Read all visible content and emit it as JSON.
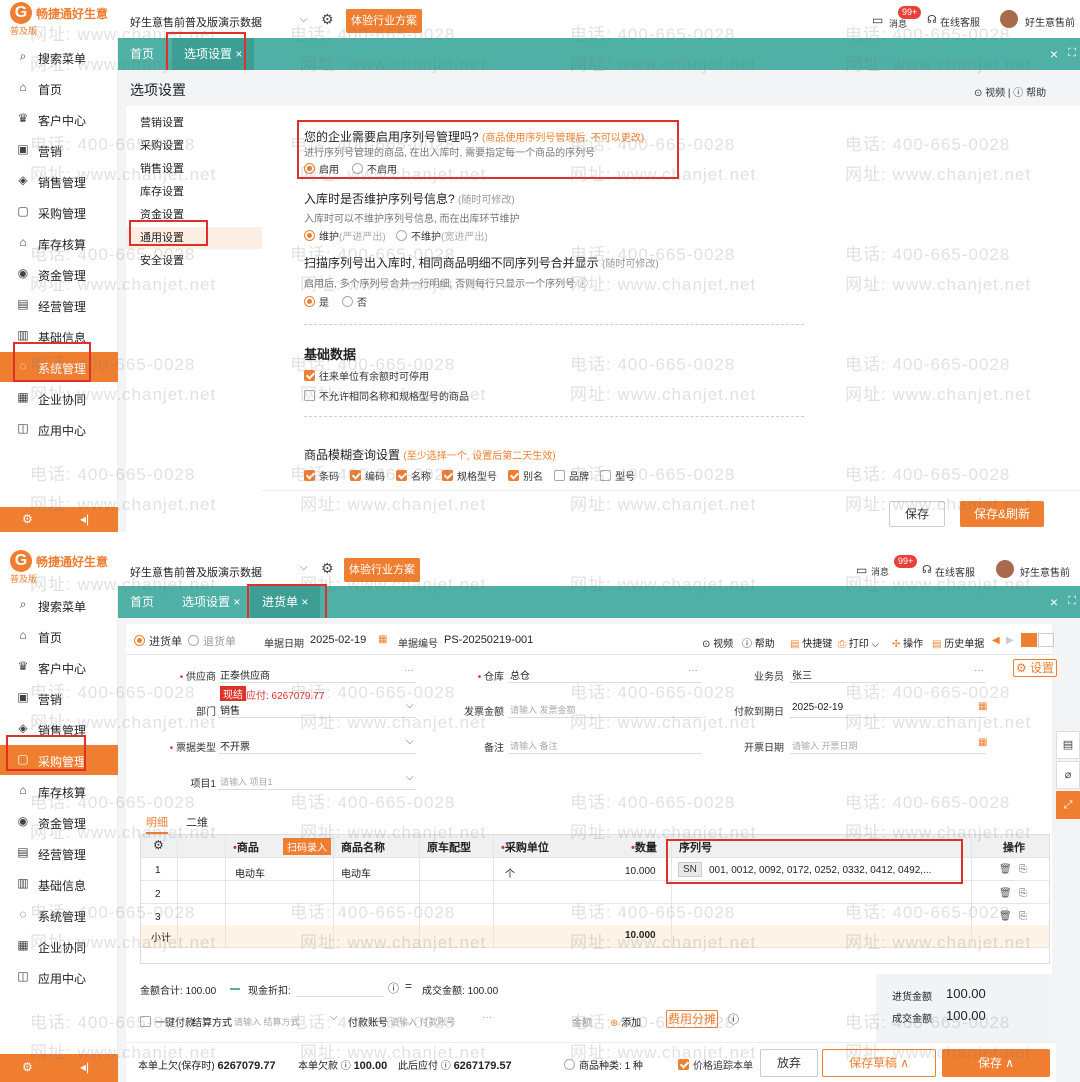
{
  "brand": {
    "name": "畅捷通好生意",
    "edition": "普及版",
    "logo_letter": "G"
  },
  "topbar": {
    "org_name": "好生意售前普及版演示数据",
    "try_button": "体验行业方案",
    "messages_label": "消息",
    "messages_badge": "99+",
    "service_label": "在线客服",
    "user_name": "好生意售前"
  },
  "sidebar": {
    "items": [
      {
        "icon": "search-icon",
        "glyph": "⌕",
        "label": "搜索菜单"
      },
      {
        "icon": "home-icon",
        "glyph": "⌂",
        "label": "首页"
      },
      {
        "icon": "trophy-icon",
        "glyph": "♛",
        "label": "客户中心"
      },
      {
        "icon": "gift-icon",
        "glyph": "▣",
        "label": "营销"
      },
      {
        "icon": "sales-icon",
        "glyph": "◈",
        "label": "销售管理"
      },
      {
        "icon": "purchase-icon",
        "glyph": "▢",
        "label": "采购管理"
      },
      {
        "icon": "warehouse-icon",
        "glyph": "⌂",
        "label": "库存核算"
      },
      {
        "icon": "money-icon",
        "glyph": "◉",
        "label": "资金管理"
      },
      {
        "icon": "report-icon",
        "glyph": "▤",
        "label": "经营管理"
      },
      {
        "icon": "info-icon",
        "glyph": "▥",
        "label": "基础信息"
      },
      {
        "icon": "system-icon",
        "glyph": "◌",
        "label": "系统管理"
      },
      {
        "icon": "cooperation-icon",
        "glyph": "▦",
        "label": "企业协同"
      },
      {
        "icon": "app-icon",
        "glyph": "◫",
        "label": "应用中心"
      }
    ],
    "footer_left_icon": "gear-icon",
    "footer_right_icon": "collapse-icon"
  },
  "watermark": {
    "phone": "电话: 400-665-0028",
    "site": "网址: www.chanjet.net"
  },
  "panel1": {
    "tabs": [
      {
        "label": "首页"
      },
      {
        "label": "选项设置 ×"
      }
    ],
    "page_title": "选项设置",
    "help_links": "⊙ 视频 | ⓘ 帮助",
    "settings_menu": [
      "营销设置",
      "采购设置",
      "销售设置",
      "库存设置",
      "资金设置",
      "通用设置",
      "安全设置"
    ],
    "serial_section": {
      "title": "您的企业需要启用序列号管理吗?",
      "hint": "(商品使用序列号管理后, 不可以更改)",
      "desc": "进行序列号管理的商品, 在出入库时, 需要指定每一个商品的序列号",
      "opt_on": "启用",
      "opt_off": "不启用"
    },
    "maintain_section": {
      "title": "入库时是否维护序列号信息?",
      "hint": "(随时可修改)",
      "desc": "入库时可以不维护序列号信息, 而在出库环节维护",
      "opt_on": "维护",
      "opt_on_note": "(严进严出)",
      "opt_off": "不维护",
      "opt_off_note": "(宽进严出)"
    },
    "merge_section": {
      "title": "扫描序列号出入库时, 相同商品明细不同序列号合并显示",
      "hint": "(随时可修改)",
      "desc": "启用后, 多个序列号合并一行明细, 否则每行只显示一个序列号 ⓘ",
      "opt_yes": "是",
      "opt_no": "否"
    },
    "basic_section": {
      "title": "基础数据",
      "cb1": "往来单位有余额时可停用",
      "cb2": "不允许相同名称和规格型号的商品"
    },
    "fuzzy_section": {
      "title": "商品模糊查询设置",
      "hint": "(至少选择一个, 设置后第二天生效)",
      "options": [
        {
          "label": "条码",
          "checked": true
        },
        {
          "label": "编码",
          "checked": true
        },
        {
          "label": "名称",
          "checked": true
        },
        {
          "label": "规格型号",
          "checked": true
        },
        {
          "label": "别名",
          "checked": true
        },
        {
          "label": "品牌",
          "checked": false
        },
        {
          "label": "型号",
          "checked": false
        }
      ]
    },
    "btn_save": "保存",
    "btn_save_refresh": "保存&刷新"
  },
  "panel2": {
    "tabs": [
      {
        "label": "首页"
      },
      {
        "label": "选项设置 ×"
      },
      {
        "label": "进货单 ×"
      }
    ],
    "doc_type_on": "进货单",
    "doc_type_off": "退货单",
    "date_label": "单据日期",
    "date_value": "2025-02-19",
    "no_label": "单据编号",
    "no_value": "PS-20250219-001",
    "toolbar": [
      "⊙ 视频",
      "ⓘ 帮助",
      "快捷键",
      "打印",
      "操作",
      "历史单据"
    ],
    "settings_btn": "⚙ 设置",
    "form": {
      "supplier_label": "供应商",
      "supplier_value": "正泰供应商",
      "supplier_tag": "现结",
      "supplier_payable": "应付: 6267079.77",
      "warehouse_label": "仓库",
      "warehouse_value": "总仓",
      "salesman_label": "业务员",
      "salesman_value": "张三",
      "dept_label": "部门",
      "dept_value": "销售",
      "invoice_amt_label": "发票金额",
      "invoice_amt_ph": "请输入 发票金额",
      "due_label": "付款到期日",
      "due_value": "2025-02-19",
      "bill_type_label": "票据类型",
      "bill_type_value": "不开票",
      "remark_label": "备注",
      "remark_ph": "请输入 备注",
      "invoice_date_label": "开票日期",
      "invoice_date_ph": "请输入 开票日期",
      "item1_label": "项目1",
      "item1_ph": "请输入 项目1"
    },
    "subtabs": [
      "明细",
      "二维"
    ],
    "grid": {
      "headers": {
        "product": "商品",
        "scan": "扫码录入",
        "name": "商品名称",
        "config": "原车配型",
        "unit": "采购单位",
        "qty": "数量",
        "serial": "序列号",
        "action": "操作"
      },
      "rows": [
        {
          "no": "1",
          "product": "电动车",
          "name": "电动车",
          "unit": "个",
          "qty": "10.000",
          "sn_tag": "SN",
          "serial": "001, 0012, 0092, 0172, 0252, 0332, 0412, 0492,..."
        },
        {
          "no": "2"
        },
        {
          "no": "3"
        }
      ],
      "subtotal_label": "小计",
      "subtotal_qty": "10.000"
    },
    "totals_line": {
      "amount_label": "金额合计:",
      "amount_value": "100.00",
      "discount_label": "现金折扣:",
      "deal_label": "成交金额:",
      "deal_value": "100.00"
    },
    "pay_line": {
      "one_click": "一键付款",
      "method_label": "结算方式",
      "method_ph": "请输入 结算方式",
      "account_label": "付款账号",
      "account_ph": "请输入 付款账号",
      "amount_label": "金额",
      "add_label": "添加",
      "fee_btn": "费用分摊"
    },
    "summary": {
      "purchase_label": "进货金额",
      "purchase_value": "100.00",
      "deal_label": "成交金额",
      "deal_value": "100.00"
    },
    "footer": {
      "prev_owe_label": "本单上欠(保存时)",
      "prev_owe_value": "6267079.77",
      "this_owe_label": "本单欠款 ⓘ",
      "this_owe_value": "100.00",
      "after_label": "此后应付 ⓘ",
      "after_value": "6267179.57",
      "kinds_label": "商品种类:",
      "kinds_value": "1 种",
      "price_trace": "价格追踪本单",
      "btn_abandon": "放弃",
      "btn_draft": "保存草稿 ∧",
      "btn_save": "保存 ∧"
    }
  },
  "colors": {
    "accent": "#ef7e30",
    "teal": "#4fb0a5",
    "highlight": "#e0302a"
  }
}
